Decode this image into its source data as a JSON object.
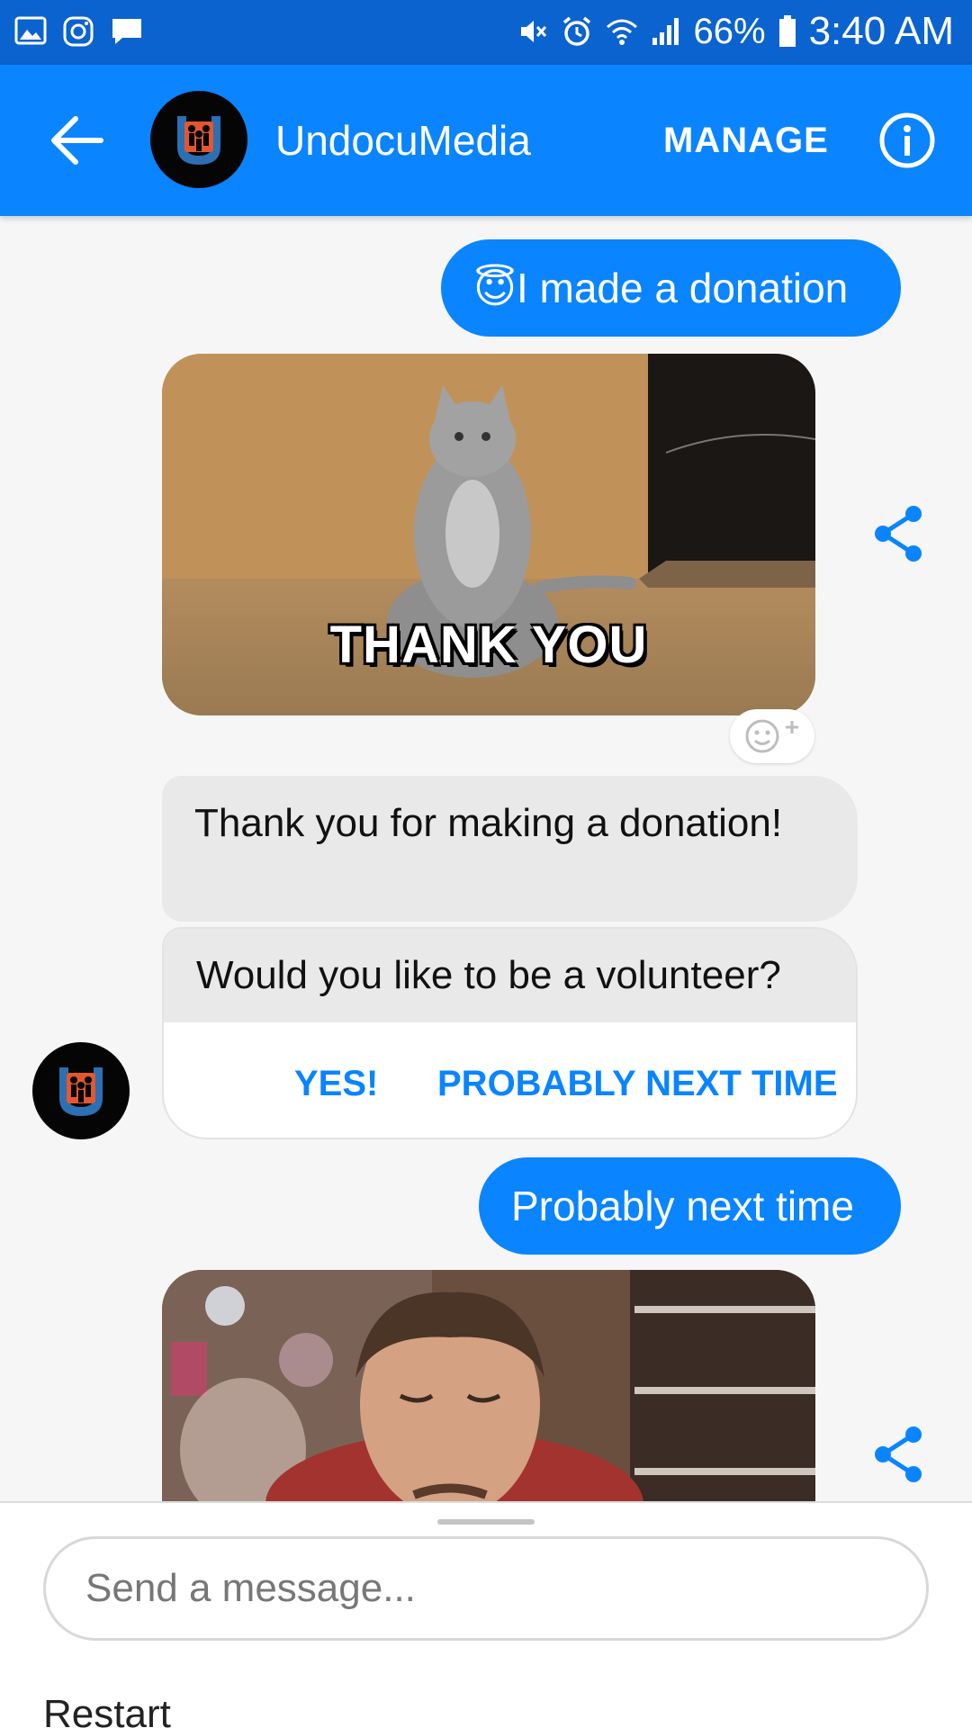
{
  "status_bar": {
    "battery": "66%",
    "time": "3:40 AM",
    "left_icons": [
      "gallery-icon",
      "instagram-icon",
      "chat-icon"
    ],
    "right_icons": [
      "mute-icon",
      "alarm-icon",
      "wifi-icon",
      "signal-icon",
      "battery-icon"
    ]
  },
  "app_bar": {
    "title": "UndocuMedia",
    "manage_label": "MANAGE",
    "back_icon": "arrow-left-icon",
    "info_icon": "info-icon"
  },
  "messages": {
    "out_1": "I made a donation",
    "out_1_emoji": "😇",
    "gif_1_caption": "THANK YOU",
    "in_1": "Thank you for making a donation!",
    "in_2_question": "Would you like to be a volunteer?",
    "quick_replies": [
      "YES!",
      "PROBABLY NEXT TIME"
    ],
    "out_2": "Probably next time"
  },
  "composer": {
    "placeholder": "Send a message...",
    "menu_item": "Restart"
  },
  "colors": {
    "status_bar": "#0b63cf",
    "app_bar": "#0a84ff",
    "outgoing_bubble": "#0a84ff",
    "incoming_bubble": "#e9e9e9",
    "background": "#f6f6f6",
    "logo_orange": "#e4572e"
  }
}
